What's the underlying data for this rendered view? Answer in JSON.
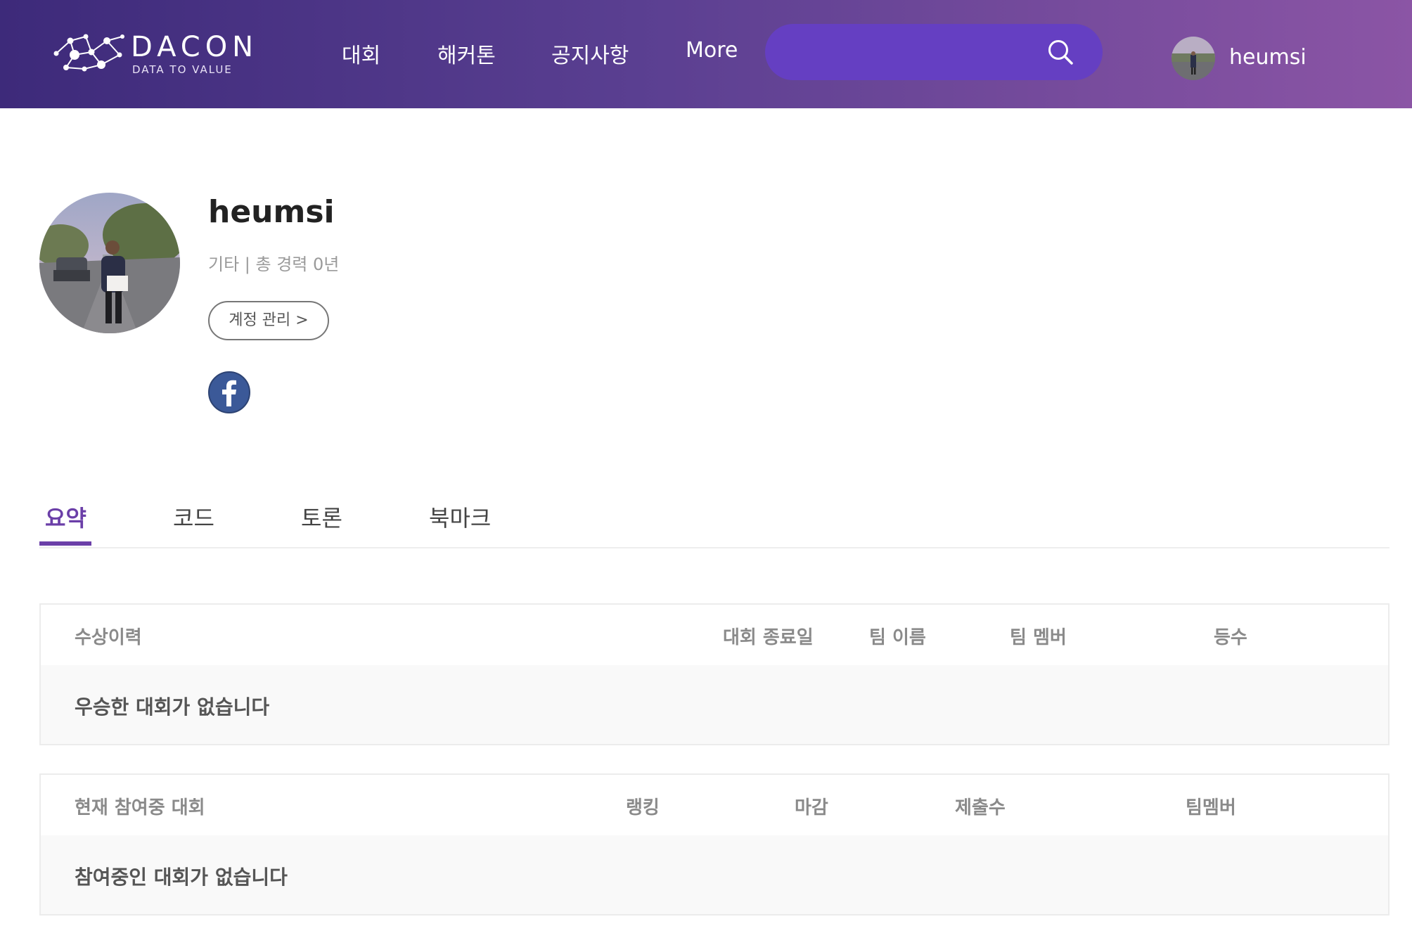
{
  "header": {
    "logo": {
      "name": "DACON",
      "tagline": "DATA TO VALUE"
    },
    "nav": [
      {
        "label": "대회"
      },
      {
        "label": "해커톤"
      },
      {
        "label": "공지사항"
      },
      {
        "label": "More"
      }
    ],
    "search": {
      "placeholder": "",
      "value": ""
    },
    "user": {
      "name": "heumsi"
    }
  },
  "profile": {
    "name": "heumsi",
    "meta": "기타 | 총 경력 0년",
    "account_button": "계정 관리 >"
  },
  "tabs": [
    {
      "label": "요약",
      "active": true
    },
    {
      "label": "코드",
      "active": false
    },
    {
      "label": "토론",
      "active": false
    },
    {
      "label": "북마크",
      "active": false
    }
  ],
  "awards_table": {
    "columns": [
      "수상이력",
      "대회 종료일",
      "팀 이름",
      "팀 멤버",
      "등수"
    ],
    "empty_message": "우승한 대회가 없습니다"
  },
  "current_table": {
    "columns": [
      "현재 참여중 대회",
      "랭킹",
      "마감",
      "제출수",
      "팀멤버"
    ],
    "empty_message": "참여중인 대회가 없습니다"
  },
  "colors": {
    "header_gradient_start": "#3d2a7a",
    "header_gradient_end": "#8b55a5",
    "search_bg": "#653fc2",
    "accent": "#6b3fa8",
    "facebook": "#3b5998"
  },
  "icons": {
    "search": "search-icon",
    "facebook": "facebook-icon",
    "logo_mark": "network-logo-icon"
  }
}
